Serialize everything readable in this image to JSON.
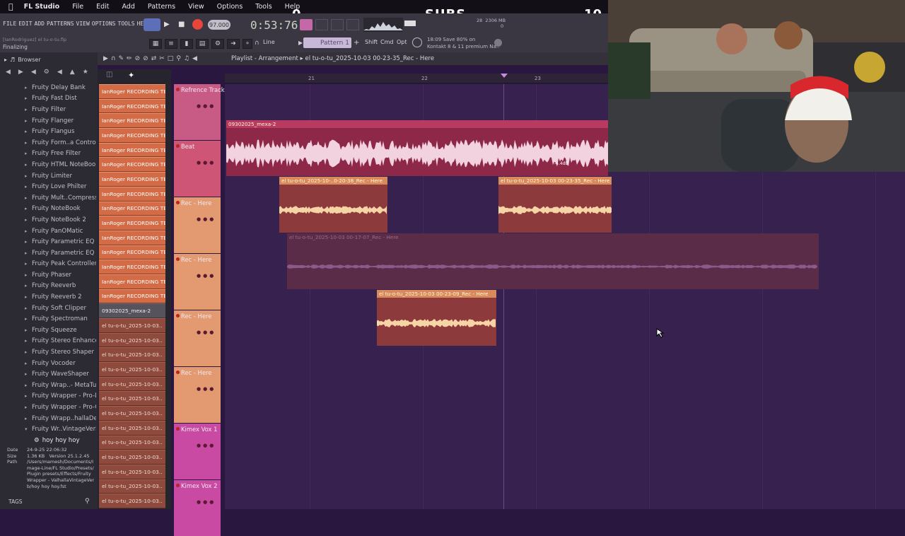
{
  "menubar": {
    "apple": "",
    "app": "FL Studio",
    "items": [
      "File",
      "Edit",
      "Add",
      "Patterns",
      "View",
      "Options",
      "Tools",
      "Help"
    ]
  },
  "stream": {
    "subs_current": "0",
    "subs_label": "SUBS",
    "subs_goal": "10"
  },
  "toolbar": {
    "fl_menu": [
      "FILE",
      "EDIT",
      "ADD",
      "PATTERNS",
      "VIEW",
      "OPTIONS",
      "TOOLS",
      "HELP"
    ],
    "project_hint": "[IanRodriguez] el tu-o-tu.flp",
    "hint_status": "Finalizing",
    "tempo": "97.000",
    "time": "0:53:76",
    "pattern": "Pattern 1",
    "snap": "Line",
    "modifiers": [
      "Shift",
      "Cmd",
      "Opt"
    ],
    "news_line1": "18:09  Save 80% on",
    "news_line2": "Kontakt 8 & 11 premium Na..",
    "meter_a": "28",
    "meter_b": "2306 MB",
    "meter_c": "0"
  },
  "browser": {
    "title": "Browser",
    "items": [
      "Fruity Delay Bank",
      "Fruity Fast Dist",
      "Fruity Filter",
      "Fruity Flanger",
      "Fruity Flangus",
      "Fruity Form..a Controller",
      "Fruity Free Filter",
      "Fruity HTML NoteBook",
      "Fruity Limiter",
      "Fruity Love Philter",
      "Fruity Mult..Compressor",
      "Fruity NoteBook",
      "Fruity NoteBook 2",
      "Fruity PanOMatic",
      "Fruity Parametric EQ",
      "Fruity Parametric EQ 2",
      "Fruity Peak Controller",
      "Fruity Phaser",
      "Fruity Reeverb",
      "Fruity Reeverb 2",
      "Fruity Soft Clipper",
      "Fruity Spectroman",
      "Fruity Squeeze",
      "Fruity Stereo Enhancer",
      "Fruity Stereo Shaper",
      "Fruity Vocoder",
      "Fruity WaveShaper",
      "Fruity Wrap..- MetaTune",
      "Fruity Wrapper - Pro-DS",
      "Fruity Wrapper - Pro-Q 3",
      "Fruity Wrapp..hallaDelay",
      "Fruity Wr..VintageVerb"
    ],
    "selected_item": "hoy hoy hoy",
    "info": {
      "date_label": "Date",
      "date": "24-9-25 22:06:32",
      "size_label": "Size",
      "size": "1.36 KB",
      "version_label": "Version",
      "version": "25.1.2.45",
      "path_label": "Path",
      "path": "/Users/mamesh/Documents/Image-Line/FL Studio/Presets/Plugin presets/Effects/Fruity Wrapper - ValhallaVintageVerb/hoy hoy hoy.fst"
    },
    "tags": "TAGS"
  },
  "picker": {
    "items": [
      {
        "label": "IanRoger RECORDING TE..",
        "kind": "pat"
      },
      {
        "label": "IanRoger RECORDING TE..",
        "kind": "pat"
      },
      {
        "label": "IanRoger RECORDING TE..",
        "kind": "pat"
      },
      {
        "label": "IanRoger RECORDING TE..",
        "kind": "pat"
      },
      {
        "label": "IanRoger RECORDING TE..",
        "kind": "pat"
      },
      {
        "label": "IanRoger RECORDING TE..",
        "kind": "pat"
      },
      {
        "label": "IanRoger RECORDING TE..",
        "kind": "pat"
      },
      {
        "label": "IanRoger RECORDING TE..",
        "kind": "pat"
      },
      {
        "label": "IanRoger RECORDING TE..",
        "kind": "pat"
      },
      {
        "label": "IanRoger RECORDING TE..",
        "kind": "pat"
      },
      {
        "label": "IanRoger RECORDING TE..",
        "kind": "pat"
      },
      {
        "label": "IanRoger RECORDING TE..",
        "kind": "pat"
      },
      {
        "label": "IanRoger RECORDING TE..",
        "kind": "pat"
      },
      {
        "label": "IanRoger RECORDING TE..",
        "kind": "pat"
      },
      {
        "label": "IanRoger RECORDING TE..",
        "kind": "pat"
      },
      {
        "label": "09302025_mexa-2",
        "kind": "sel"
      },
      {
        "label": "el tu-o-tu_2025-10-03..",
        "kind": "aud"
      },
      {
        "label": "el tu-o-tu_2025-10-03..",
        "kind": "aud"
      },
      {
        "label": "el tu-o-tu_2025-10-03..",
        "kind": "aud"
      },
      {
        "label": "el tu-o-tu_2025-10-03..",
        "kind": "aud"
      },
      {
        "label": "el tu-o-tu_2025-10-03..",
        "kind": "aud"
      },
      {
        "label": "el tu-o-tu_2025-10-03..",
        "kind": "aud"
      },
      {
        "label": "el tu-o-tu_2025-10-03..",
        "kind": "aud"
      },
      {
        "label": "el tu-o-tu_2025-10-03..",
        "kind": "aud"
      },
      {
        "label": "el tu-o-tu_2025-10-03..",
        "kind": "aud"
      },
      {
        "label": "el tu-o-tu_2025-10-03..",
        "kind": "aud"
      },
      {
        "label": "el tu-o-tu_2025-10-03..",
        "kind": "aud"
      },
      {
        "label": "el tu-o-tu_2025-10-03..",
        "kind": "aud"
      },
      {
        "label": "el tu-o-tu_2025-10-03..",
        "kind": "aud"
      }
    ]
  },
  "playlist": {
    "title": "Playlist - Arrangement",
    "breadcrumb": "el tu-o-tu_2025-10-03 00-23-35_Rec - Here",
    "ruler": [
      "21",
      "22",
      "23"
    ],
    "tracks": [
      {
        "name": "Refrence Track",
        "color": "#c85a86"
      },
      {
        "name": "Beat",
        "color": "#cf5577"
      },
      {
        "name": "Rec - Here",
        "color": "#e39a70"
      },
      {
        "name": "Rec - Here",
        "color": "#e39a70"
      },
      {
        "name": "Rec - Here",
        "color": "#e39a70"
      },
      {
        "name": "Rec - Here",
        "color": "#e39a70"
      },
      {
        "name": "Kimex Vox 1",
        "color": "#c84aa2"
      },
      {
        "name": "Kimex Vox 2",
        "color": "#c84aa2"
      }
    ],
    "clips": {
      "beat": "09302025_mexa-2",
      "beat_gain": "-4.4dB",
      "rec1a": "el tu-o-tu_2025-10-..0-20-38_Rec - Here",
      "rec1b": "el tu-o-tu_2025-10-03 00-23-35_Rec - Here",
      "rec2": "el tu-o-tu_2025-10-03 00-17-07_Rec - Here",
      "rec3": "el tu-o-tu_2025-10-03 00-23-09_Rec - Here"
    }
  },
  "colors": {
    "grid": "#36214f",
    "clip_rec": "#d4875c",
    "clip_beat": "#c43b66",
    "pattern_item": "#d26b46"
  }
}
